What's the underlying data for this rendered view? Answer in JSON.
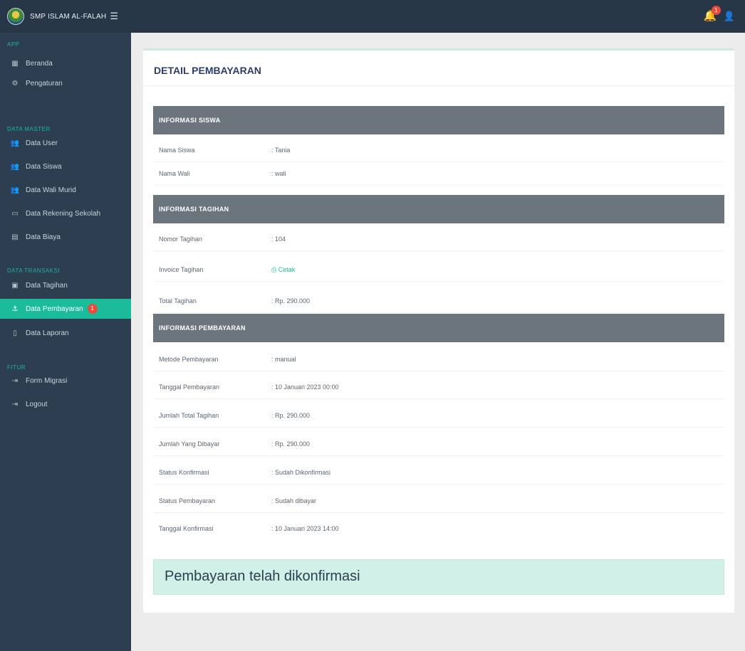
{
  "brand": {
    "name": "SMP ISLAM AL-FALAH",
    "toggle_icon": "menu-fold-icon"
  },
  "topbar": {
    "notification_count": "1"
  },
  "sidebar": {
    "sections": [
      {
        "title": "APP"
      },
      {
        "title": "DATA MASTER"
      },
      {
        "title": "DATA TRANSAKSI"
      },
      {
        "title": "FITUR"
      }
    ],
    "items": [
      {
        "label": "Beranda",
        "icon": "grid-icon"
      },
      {
        "label": "Pengaturan",
        "icon": "gear-icon"
      },
      {
        "label": "Data User",
        "icon": "users-icon"
      },
      {
        "label": "Data Siswa",
        "icon": "users-icon"
      },
      {
        "label": "Data Wali Murid",
        "icon": "users-icon"
      },
      {
        "label": "Data Rekening Sekolah",
        "icon": "card-icon"
      },
      {
        "label": "Data Biaya",
        "icon": "money-icon"
      },
      {
        "label": "Data Tagihan",
        "icon": "calendar-icon"
      },
      {
        "label": "Data Pembayaran",
        "icon": "anchor-icon",
        "badge": "1"
      },
      {
        "label": "Data Laporan",
        "icon": "file-icon"
      },
      {
        "label": "Form Migrasi",
        "icon": "sign-in-icon"
      },
      {
        "label": "Logout",
        "icon": "sign-out-icon"
      }
    ]
  },
  "card": {
    "title": "DETAIL PEMBAYARAN",
    "sections": [
      {
        "title": "INFORMASI SISWA",
        "rows": [
          {
            "label": "Nama Siswa",
            "value": ": Tania"
          },
          {
            "label": "Nama Wali",
            "value": ": wali"
          }
        ]
      },
      {
        "title": "INFORMASI TAGIHAN",
        "rows": [
          {
            "label": "Nomor Tagihan",
            "value": ": 104"
          },
          {
            "label": "Invoice Tagihan",
            "value": "Cetak",
            "link": true
          },
          {
            "label": "Total Tagihan",
            "value": ": Rp. 290.000"
          }
        ]
      },
      {
        "title": "INFORMASI PEMBAYARAN",
        "rows": [
          {
            "label": "Metode Pembayaran",
            "value": ": manual"
          },
          {
            "label": "Tanggal Pembayaran",
            "value": ": 10 Januari 2023 00:00"
          },
          {
            "label": "Jumlah Total Tagihan",
            "value": ": Rp. 290.000"
          },
          {
            "label": "Jumlah Yang Dibayar",
            "value": ": Rp. 290.000"
          },
          {
            "label": "Status Konfirmasi",
            "value": ": Sudah Dikonfirmasi"
          },
          {
            "label": "Status Pembayaran",
            "value": ": Sudah dibayar"
          },
          {
            "label": "Tanggal Konfirmasi",
            "value": ": 10 Januari 2023 14:00"
          }
        ]
      }
    ],
    "alert": "Pembayaran telah dikonfirmasi"
  },
  "colors": {
    "sidebar": "#2c3e50",
    "accent": "#1abc9c",
    "section_header": "#6c757d",
    "alert_bg": "#d1f0e7"
  }
}
